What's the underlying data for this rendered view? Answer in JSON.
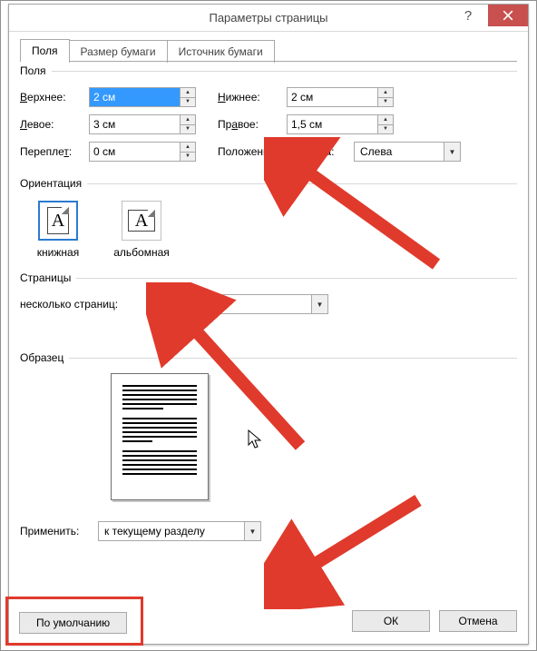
{
  "dialog": {
    "title": "Параметры страницы"
  },
  "tabs": {
    "items": [
      {
        "label": "Поля",
        "active": true
      },
      {
        "label": "Размер бумаги",
        "active": false
      },
      {
        "label": "Источник бумаги",
        "active": false
      }
    ]
  },
  "margins": {
    "group_label": "Поля",
    "top_label": "Верхнее:",
    "top": "2 см",
    "bottom_label": "Нижнее:",
    "bottom": "2 см",
    "left_label": "Левое:",
    "left": "3 см",
    "right_label": "Правое:",
    "right": "1,5 см",
    "gutter_label": "Переплет:",
    "gutter": "0 см",
    "gutter_pos_label": "Положение переплета:",
    "gutter_pos": "Слева"
  },
  "orientation": {
    "group_label": "Ориентация",
    "portrait": "книжная",
    "landscape": "альбомная",
    "selected": "portrait"
  },
  "pages": {
    "group_label": "Страницы",
    "multi_label": "несколько страниц:",
    "multi_value": "Обычный"
  },
  "preview": {
    "group_label": "Образец"
  },
  "apply": {
    "label": "Применить:",
    "value": "к текущему разделу"
  },
  "buttons": {
    "default": "По умолчанию",
    "ok": "ОК",
    "cancel": "Отмена"
  }
}
